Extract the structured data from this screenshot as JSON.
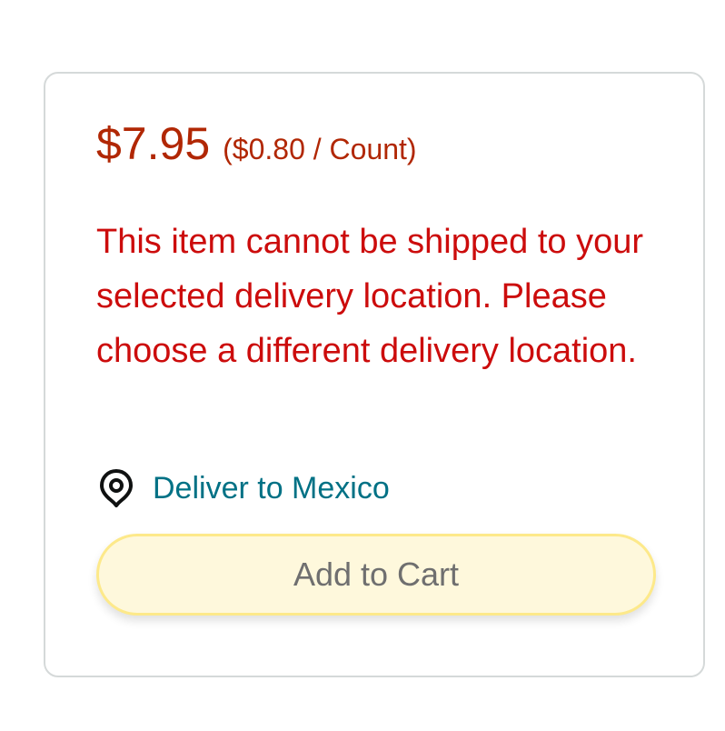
{
  "buybox": {
    "price": "$7.95",
    "unit_price": "($0.80 / Count)",
    "shipping_warning": "This item cannot be shipped to your selected delivery location. Please choose a different delivery location.",
    "deliver_to_label": "Deliver to Mexico",
    "deliver_icon": "location-pin-icon",
    "add_to_cart_label": "Add to Cart",
    "add_to_cart_disabled": true
  },
  "colors": {
    "price": "#b12704",
    "warning": "#cc0c0c",
    "link": "#007185",
    "button_bg": "#fef8dc",
    "button_border": "#fde98a",
    "button_text": "#6f6f6f",
    "card_border": "#d5d9d9"
  }
}
